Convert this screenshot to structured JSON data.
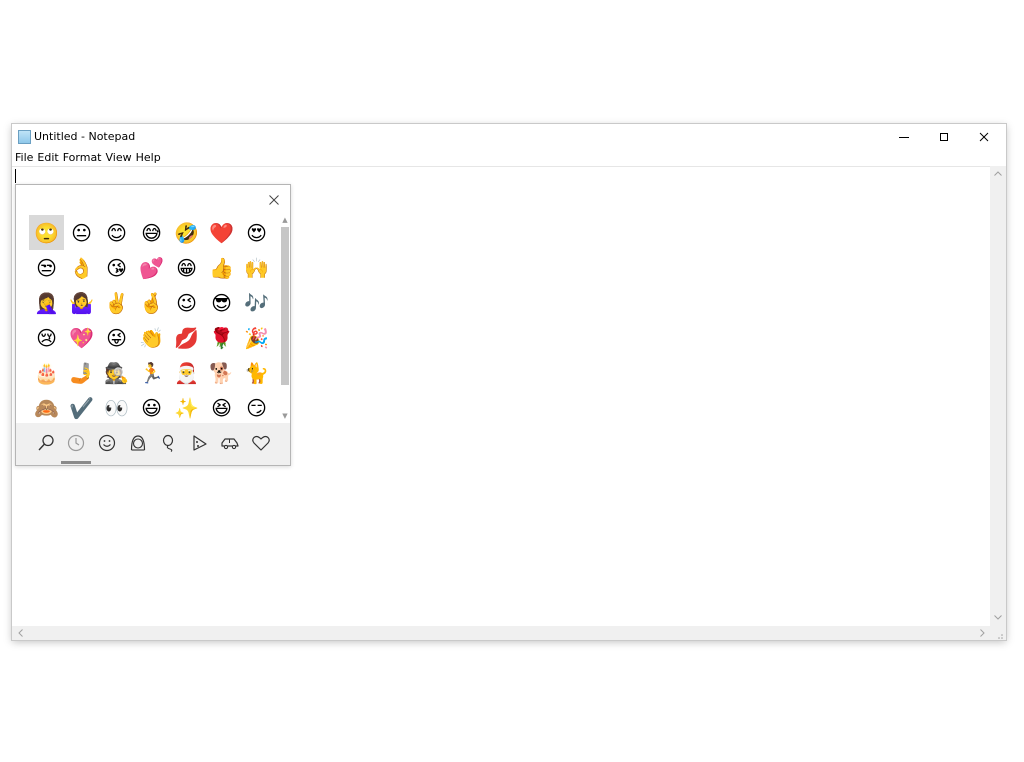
{
  "window": {
    "title": "Untitled - Notepad",
    "menu": [
      "File",
      "Edit",
      "Format",
      "View",
      "Help"
    ],
    "editor_text": ""
  },
  "emoji_panel": {
    "emojis": [
      "🙄",
      "😐",
      "😊",
      "😅",
      "🤣",
      "❤️",
      "😍",
      "😒",
      "👌",
      "😘",
      "💕",
      "😁",
      "👍",
      "🙌",
      "🤦‍♀️",
      "🤷‍♀️",
      "✌️",
      "🤞",
      "😉",
      "😎",
      "🎶",
      "😢",
      "💖",
      "😜",
      "👏",
      "💋",
      "🌹",
      "🎉",
      "🎂",
      "🤳",
      "🕵️",
      "🏃",
      "🎅",
      "🐕",
      "🐈",
      "🙈",
      "✔️",
      "👀",
      "😃",
      "✨",
      "😆",
      "😏"
    ],
    "selected_index": 0,
    "categories": [
      "search-icon",
      "recent-clock-icon",
      "smiley-face-icon",
      "people-icon",
      "celebration-balloon-icon",
      "food-pizza-icon",
      "travel-car-icon",
      "heart-icon"
    ],
    "active_category": 1
  }
}
